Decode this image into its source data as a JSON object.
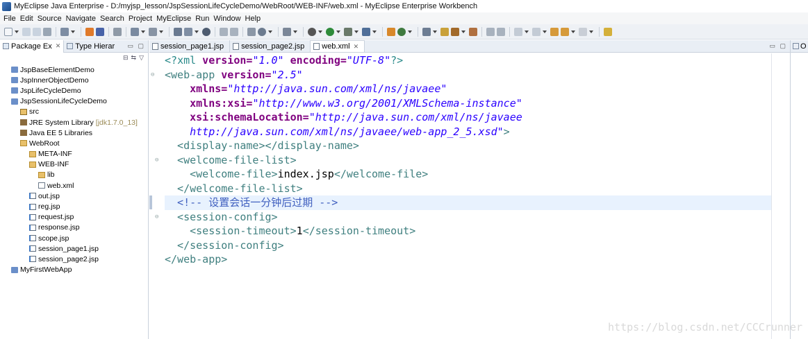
{
  "window": {
    "title": "MyEclipse Java Enterprise - D:/myjsp_lesson/JspSessionLifeCycleDemo/WebRoot/WEB-INF/web.xml - MyEclipse Enterprise Workbench"
  },
  "menu": [
    "File",
    "Edit",
    "Source",
    "Navigate",
    "Search",
    "Project",
    "MyEclipse",
    "Run",
    "Window",
    "Help"
  ],
  "left_panel": {
    "tabs": [
      {
        "label": "Package Ex",
        "close": "✕"
      },
      {
        "label": "Type Hierar"
      }
    ],
    "tree": [
      {
        "label": "JspBaseElementDemo",
        "type": "project"
      },
      {
        "label": "JspInnerObjectDemo",
        "type": "project"
      },
      {
        "label": "JspLifeCycleDemo",
        "type": "project"
      },
      {
        "label": "JspSessionLifeCycleDemo",
        "type": "project"
      },
      {
        "label": "src",
        "type": "src"
      },
      {
        "label": "JRE System Library",
        "suffix": "[jdk1.7.0_13]",
        "type": "lib"
      },
      {
        "label": "Java EE 5 Libraries",
        "type": "lib"
      },
      {
        "label": "WebRoot",
        "type": "folder"
      },
      {
        "label": "META-INF",
        "type": "folder"
      },
      {
        "label": "WEB-INF",
        "type": "folder"
      },
      {
        "label": "lib",
        "type": "folder"
      },
      {
        "label": "web.xml",
        "type": "file"
      },
      {
        "label": "out.jsp",
        "type": "jsp"
      },
      {
        "label": "reg.jsp",
        "type": "jsp"
      },
      {
        "label": "request.jsp",
        "type": "jsp"
      },
      {
        "label": "response.jsp",
        "type": "jsp"
      },
      {
        "label": "scope.jsp",
        "type": "jsp"
      },
      {
        "label": "session_page1.jsp",
        "type": "jsp"
      },
      {
        "label": "session_page2.jsp",
        "type": "jsp"
      },
      {
        "label": "MyFirstWebApp",
        "type": "project"
      }
    ]
  },
  "editor": {
    "tabs": [
      {
        "label": "session_page1.jsp",
        "active": false
      },
      {
        "label": "session_page2.jsp",
        "active": false
      },
      {
        "label": "web.xml",
        "active": true,
        "close": "✕"
      }
    ],
    "lines": [
      {
        "p": "<?",
        "tag": "xml",
        "a1": " version=",
        "v1": "\"1.0\"",
        "a2": " encoding=",
        "v2": "\"UTF-8\"",
        "e": "?>"
      },
      {
        "tag": "<web-app",
        "a1": " version=",
        "v1": "\"2.5\""
      },
      {
        "a1": "    xmlns=",
        "v1": "\"http://java.sun.com/xml/ns/javaee\""
      },
      {
        "a1": "    xmlns:xsi=",
        "v1": "\"http://www.w3.org/2001/XMLSchema-instance\""
      },
      {
        "a1": "    xsi:schemaLocation=",
        "v1": "\"http://java.sun.com/xml/ns/javaee"
      },
      {
        "v1": "    http://java.sun.com/xml/ns/javaee/web-app_2_5.xsd\"",
        "e": ">"
      },
      {
        "tag": "  <display-name></display-name>"
      },
      {
        "tag": "  <welcome-file-list>"
      },
      {
        "tag": "    <welcome-file>",
        "text": "index.jsp",
        "e": "</welcome-file>"
      },
      {
        "tag": "  </welcome-file-list>"
      },
      {
        "comment": "  <!-- 设置会话一分钟后过期 -->"
      },
      {
        "tag": "  <session-config>"
      },
      {
        "tag": "    <session-timeout>",
        "text": "1",
        "e": "</session-timeout>"
      },
      {
        "tag": "  </session-config>"
      },
      {
        "tag": "</web-app>"
      }
    ]
  },
  "right_panel": {
    "label": "O"
  },
  "watermark": "https://blog.csdn.net/CCCrunner"
}
